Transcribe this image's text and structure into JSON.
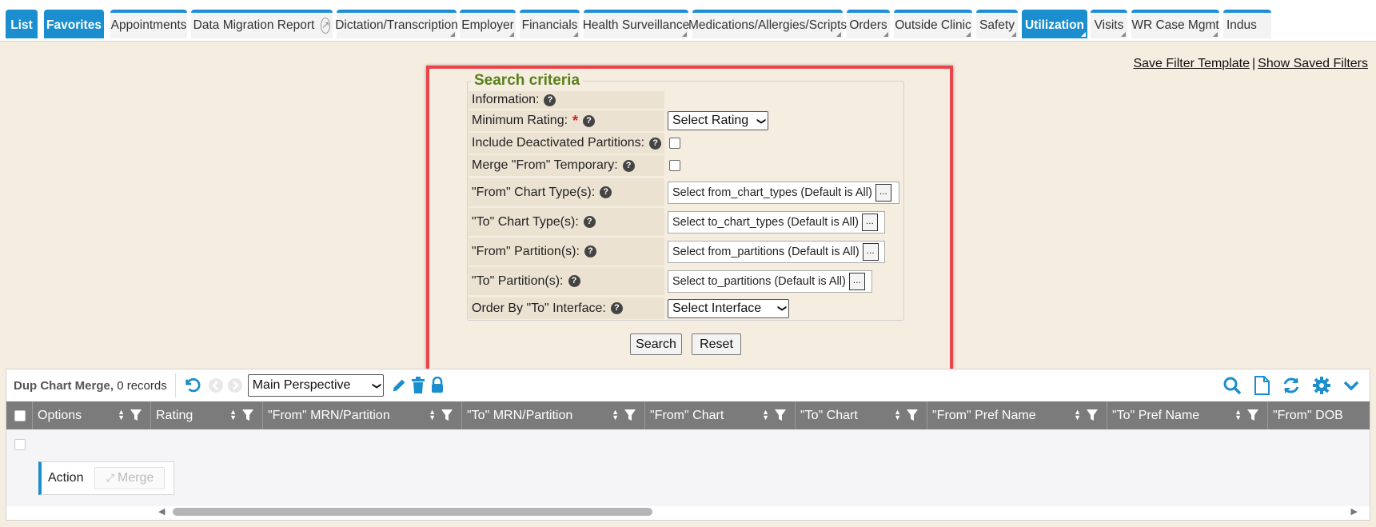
{
  "tabs": [
    {
      "label": "List",
      "style": "blue"
    },
    {
      "label": "Favorites",
      "style": "blue"
    },
    {
      "label": "Appointments"
    },
    {
      "label": "Data Migration Report"
    },
    {
      "label": "Dictation/Transcription"
    },
    {
      "label": "Employer"
    },
    {
      "label": "Financials"
    },
    {
      "label": "Health Surveillance"
    },
    {
      "label": "Medications/Allergies/Scripts"
    },
    {
      "label": "Orders"
    },
    {
      "label": "Outside Clinic"
    },
    {
      "label": "Safety"
    },
    {
      "label": "Utilization",
      "style": "blue"
    },
    {
      "label": "Visits"
    },
    {
      "label": "WR Case Mgmt"
    },
    {
      "label": "Indus"
    }
  ],
  "filter_links": {
    "save_template": "Save Filter Template",
    "separator": "|",
    "show_saved": "Show Saved Filters"
  },
  "criteria": {
    "legend": "Search criteria",
    "information": "Information:",
    "min_rating": "Minimum Rating:",
    "required_mark": "*",
    "rating_select": "Select Rating",
    "include_deactivated": "Include Deactivated Partitions:",
    "merge_from_temp": "Merge \"From\" Temporary:",
    "from_chart_types": "\"From\" Chart Type(s):",
    "from_chart_types_value": "Select from_chart_types (Default is All)",
    "to_chart_types": "\"To\" Chart Type(s):",
    "to_chart_types_value": "Select to_chart_types (Default is All)",
    "from_partitions": "\"From\" Partition(s):",
    "from_partitions_value": "Select from_partitions (Default is All)",
    "to_partitions": "\"To\" Partition(s):",
    "to_partitions_value": "Select to_partitions (Default is All)",
    "order_by": "Order By \"To\" Interface:",
    "interface_select": "Select Interface",
    "ellipsis": "...",
    "help_glyph": "?"
  },
  "buttons": {
    "search": "Search",
    "reset": "Reset"
  },
  "grid": {
    "title": "Dup Chart Merge,",
    "records": "0 records",
    "perspective": "Main Perspective",
    "columns": [
      "Options",
      "Rating",
      "\"From\" MRN/Partition",
      "\"To\" MRN/Partition",
      "\"From\" Chart",
      "\"To\" Chart",
      "\"From\" Pref Name",
      "\"To\" Pref Name",
      "\"From\" DOB"
    ],
    "action_label": "Action",
    "merge_label": "Merge"
  },
  "colors": {
    "accent": "#1a8ecf",
    "legend": "#5b7f1d",
    "highlight": "#e8444a",
    "background": "#f5ede0"
  },
  "icons": {
    "undo": "undo-icon",
    "search": "search-icon",
    "document": "document-icon",
    "refresh": "refresh-icon",
    "gear": "gear-icon",
    "chevron": "chevron-down-icon"
  }
}
